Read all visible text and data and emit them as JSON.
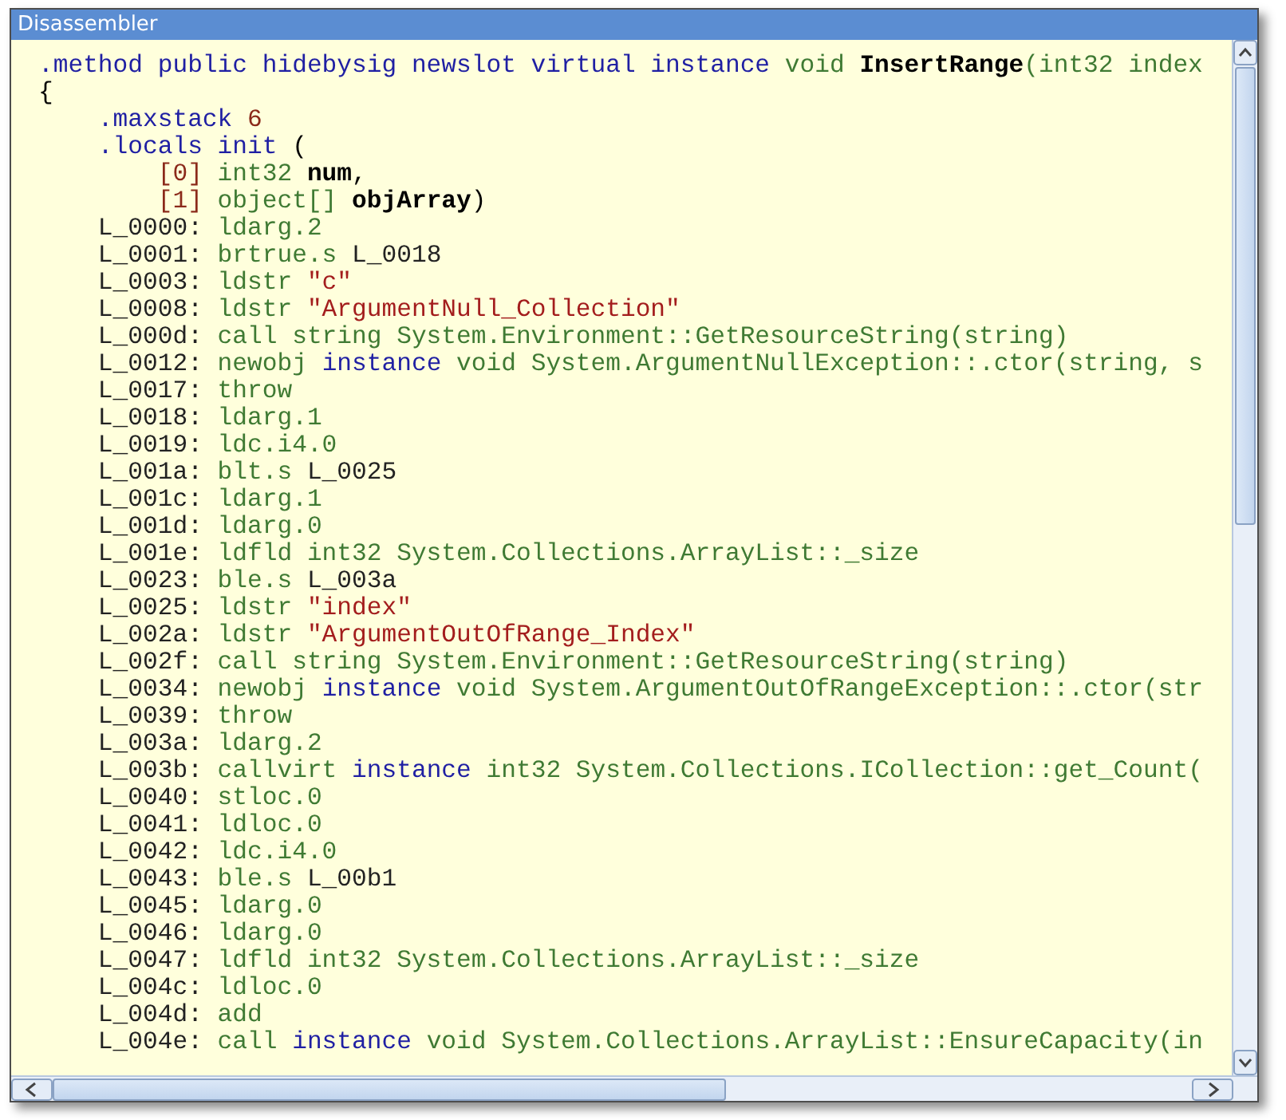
{
  "window": {
    "title": "Disassembler"
  },
  "code_lines": [
    {
      "segments": [
        {
          "text": ".method public hidebysig newslot virtual instance ",
          "kind": "keyword"
        },
        {
          "text": "void ",
          "kind": "type"
        },
        {
          "text": "InsertRange",
          "kind": "name"
        },
        {
          "text": "(int32 index",
          "kind": "type"
        }
      ]
    },
    {
      "segments": [
        {
          "text": "{",
          "kind": "plain"
        }
      ]
    },
    {
      "segments": [
        {
          "text": "    .maxstack ",
          "kind": "keyword"
        },
        {
          "text": "6",
          "kind": "number"
        }
      ]
    },
    {
      "segments": [
        {
          "text": "    .locals init ",
          "kind": "keyword"
        },
        {
          "text": "(",
          "kind": "plain"
        }
      ]
    },
    {
      "segments": [
        {
          "text": "        [0] ",
          "kind": "number"
        },
        {
          "text": "int32 ",
          "kind": "type"
        },
        {
          "text": "num",
          "kind": "name"
        },
        {
          "text": ",",
          "kind": "plain"
        }
      ]
    },
    {
      "segments": [
        {
          "text": "        [1] ",
          "kind": "number"
        },
        {
          "text": "object[] ",
          "kind": "type"
        },
        {
          "text": "objArray",
          "kind": "name"
        },
        {
          "text": ")",
          "kind": "plain"
        }
      ]
    },
    {
      "segments": [
        {
          "text": "    L_0000: ",
          "kind": "label"
        },
        {
          "text": "ldarg.2",
          "kind": "opcode"
        }
      ]
    },
    {
      "segments": [
        {
          "text": "    L_0001: ",
          "kind": "label"
        },
        {
          "text": "brtrue.s ",
          "kind": "opcode"
        },
        {
          "text": "L_0018",
          "kind": "label"
        }
      ]
    },
    {
      "segments": [
        {
          "text": "    L_0003: ",
          "kind": "label"
        },
        {
          "text": "ldstr ",
          "kind": "opcode"
        },
        {
          "text": "\"c\"",
          "kind": "string"
        }
      ]
    },
    {
      "segments": [
        {
          "text": "    L_0008: ",
          "kind": "label"
        },
        {
          "text": "ldstr ",
          "kind": "opcode"
        },
        {
          "text": "\"ArgumentNull_Collection\"",
          "kind": "string"
        }
      ]
    },
    {
      "segments": [
        {
          "text": "    L_000d: ",
          "kind": "label"
        },
        {
          "text": "call string System.Environment::GetResourceString(string)",
          "kind": "opcode"
        }
      ]
    },
    {
      "segments": [
        {
          "text": "    L_0012: ",
          "kind": "label"
        },
        {
          "text": "newobj ",
          "kind": "opcode"
        },
        {
          "text": "instance ",
          "kind": "keyword"
        },
        {
          "text": "void System.ArgumentNullException::.ctor(string, s",
          "kind": "opcode"
        }
      ]
    },
    {
      "segments": [
        {
          "text": "    L_0017: ",
          "kind": "label"
        },
        {
          "text": "throw",
          "kind": "opcode"
        }
      ]
    },
    {
      "segments": [
        {
          "text": "    L_0018: ",
          "kind": "label"
        },
        {
          "text": "ldarg.1",
          "kind": "opcode"
        }
      ]
    },
    {
      "segments": [
        {
          "text": "    L_0019: ",
          "kind": "label"
        },
        {
          "text": "ldc.i4.0",
          "kind": "opcode"
        }
      ]
    },
    {
      "segments": [
        {
          "text": "    L_001a: ",
          "kind": "label"
        },
        {
          "text": "blt.s ",
          "kind": "opcode"
        },
        {
          "text": "L_0025",
          "kind": "label"
        }
      ]
    },
    {
      "segments": [
        {
          "text": "    L_001c: ",
          "kind": "label"
        },
        {
          "text": "ldarg.1",
          "kind": "opcode"
        }
      ]
    },
    {
      "segments": [
        {
          "text": "    L_001d: ",
          "kind": "label"
        },
        {
          "text": "ldarg.0",
          "kind": "opcode"
        }
      ]
    },
    {
      "segments": [
        {
          "text": "    L_001e: ",
          "kind": "label"
        },
        {
          "text": "ldfld int32 System.Collections.ArrayList::_size",
          "kind": "opcode"
        }
      ]
    },
    {
      "segments": [
        {
          "text": "    L_0023: ",
          "kind": "label"
        },
        {
          "text": "ble.s ",
          "kind": "opcode"
        },
        {
          "text": "L_003a",
          "kind": "label"
        }
      ]
    },
    {
      "segments": [
        {
          "text": "    L_0025: ",
          "kind": "label"
        },
        {
          "text": "ldstr ",
          "kind": "opcode"
        },
        {
          "text": "\"index\"",
          "kind": "string"
        }
      ]
    },
    {
      "segments": [
        {
          "text": "    L_002a: ",
          "kind": "label"
        },
        {
          "text": "ldstr ",
          "kind": "opcode"
        },
        {
          "text": "\"ArgumentOutOfRange_Index\"",
          "kind": "string"
        }
      ]
    },
    {
      "segments": [
        {
          "text": "    L_002f: ",
          "kind": "label"
        },
        {
          "text": "call string System.Environment::GetResourceString(string)",
          "kind": "opcode"
        }
      ]
    },
    {
      "segments": [
        {
          "text": "    L_0034: ",
          "kind": "label"
        },
        {
          "text": "newobj ",
          "kind": "opcode"
        },
        {
          "text": "instance ",
          "kind": "keyword"
        },
        {
          "text": "void System.ArgumentOutOfRangeException::.ctor(str",
          "kind": "opcode"
        }
      ]
    },
    {
      "segments": [
        {
          "text": "    L_0039: ",
          "kind": "label"
        },
        {
          "text": "throw",
          "kind": "opcode"
        }
      ]
    },
    {
      "segments": [
        {
          "text": "    L_003a: ",
          "kind": "label"
        },
        {
          "text": "ldarg.2",
          "kind": "opcode"
        }
      ]
    },
    {
      "segments": [
        {
          "text": "    L_003b: ",
          "kind": "label"
        },
        {
          "text": "callvirt ",
          "kind": "opcode"
        },
        {
          "text": "instance ",
          "kind": "keyword"
        },
        {
          "text": "int32 System.Collections.ICollection::get_Count(",
          "kind": "opcode"
        }
      ]
    },
    {
      "segments": [
        {
          "text": "    L_0040: ",
          "kind": "label"
        },
        {
          "text": "stloc.0",
          "kind": "opcode"
        }
      ]
    },
    {
      "segments": [
        {
          "text": "    L_0041: ",
          "kind": "label"
        },
        {
          "text": "ldloc.0",
          "kind": "opcode"
        }
      ]
    },
    {
      "segments": [
        {
          "text": "    L_0042: ",
          "kind": "label"
        },
        {
          "text": "ldc.i4.0",
          "kind": "opcode"
        }
      ]
    },
    {
      "segments": [
        {
          "text": "    L_0043: ",
          "kind": "label"
        },
        {
          "text": "ble.s ",
          "kind": "opcode"
        },
        {
          "text": "L_00b1",
          "kind": "label"
        }
      ]
    },
    {
      "segments": [
        {
          "text": "    L_0045: ",
          "kind": "label"
        },
        {
          "text": "ldarg.0",
          "kind": "opcode"
        }
      ]
    },
    {
      "segments": [
        {
          "text": "    L_0046: ",
          "kind": "label"
        },
        {
          "text": "ldarg.0",
          "kind": "opcode"
        }
      ]
    },
    {
      "segments": [
        {
          "text": "    L_0047: ",
          "kind": "label"
        },
        {
          "text": "ldfld int32 System.Collections.ArrayList::_size",
          "kind": "opcode"
        }
      ]
    },
    {
      "segments": [
        {
          "text": "    L_004c: ",
          "kind": "label"
        },
        {
          "text": "ldloc.0",
          "kind": "opcode"
        }
      ]
    },
    {
      "segments": [
        {
          "text": "    L_004d: ",
          "kind": "label"
        },
        {
          "text": "add",
          "kind": "opcode"
        }
      ]
    },
    {
      "segments": [
        {
          "text": "    L_004e: ",
          "kind": "label"
        },
        {
          "text": "call ",
          "kind": "opcode"
        },
        {
          "text": "instance ",
          "kind": "keyword"
        },
        {
          "text": "void System.Collections.ArrayList::EnsureCapacity(in",
          "kind": "opcode"
        }
      ]
    }
  ]
}
